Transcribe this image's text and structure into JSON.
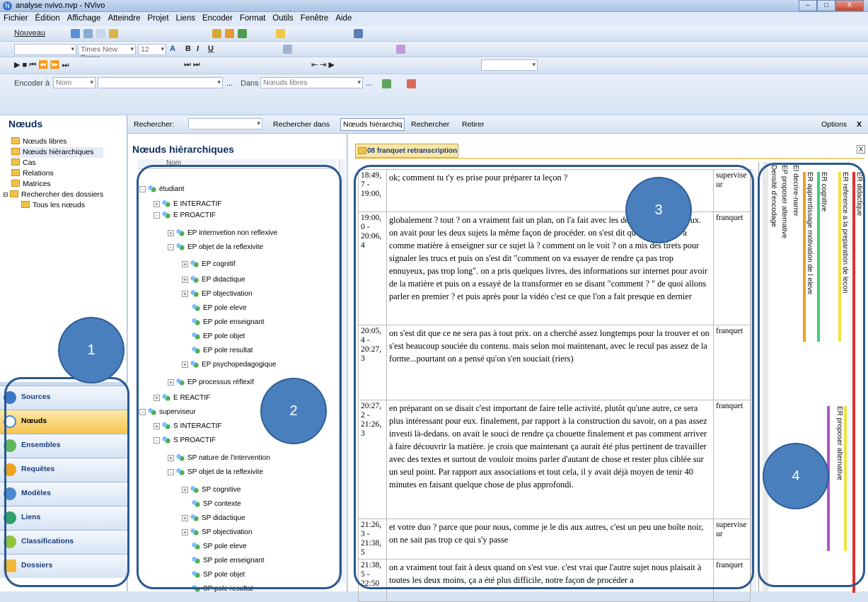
{
  "window": {
    "title": "analyse nvivo.nvp - NVivo",
    "min": "–",
    "max": "□",
    "close": "X"
  },
  "menu": [
    "Fichier",
    "Édition",
    "Affichage",
    "Atteindre",
    "Projet",
    "Liens",
    "Encoder",
    "Format",
    "Outils",
    "Fenêtre",
    "Aide"
  ],
  "toolbar": {
    "new_label": "Nouveau",
    "font_name": "Times New Roma",
    "font_size": "12",
    "encode_at": "Encoder à",
    "encode_field": "Nom",
    "in_label": "Dans",
    "in_value": "Nœuds libres"
  },
  "left": {
    "header": "Nœuds",
    "tree": [
      "Nœuds libres",
      "Nœuds hiérarchiques",
      "Cas",
      "Relations",
      "Matrices",
      "Rechercher des dossiers",
      "Tous les nœuds"
    ],
    "nav": [
      "Sources",
      "Nœuds",
      "Ensembles",
      "Requêtes",
      "Modèles",
      "Liens",
      "Classifications",
      "Dossiers"
    ]
  },
  "search": {
    "label": "Rechercher:",
    "search_in": "Rechercher dans",
    "scope": "Nœuds hiérarchiq",
    "find": "Rechercher",
    "clear": "Retirer",
    "options": "Options",
    "close": "X"
  },
  "middle": {
    "header": "Nœuds hiérarchiques",
    "col": "Nom",
    "nodes": [
      {
        "label": "étudiant",
        "lvl": 0,
        "exp": "-"
      },
      {
        "label": "E INTERACTIF",
        "lvl": 1,
        "exp": "+"
      },
      {
        "label": "E PROACTIF",
        "lvl": 1,
        "exp": "-"
      },
      {
        "label": "EP internvetion non reflexive",
        "lvl": 2,
        "exp": "+"
      },
      {
        "label": "EP objet de la reflexivite",
        "lvl": 2,
        "exp": "-"
      },
      {
        "label": "EP cognitif",
        "lvl": 3,
        "exp": "+"
      },
      {
        "label": "EP didactique",
        "lvl": 3,
        "exp": "+"
      },
      {
        "label": "EP objectivation",
        "lvl": 3,
        "exp": "+"
      },
      {
        "label": "EP pole eleve",
        "lvl": 3,
        "exp": ""
      },
      {
        "label": "EP pole enseignant",
        "lvl": 3,
        "exp": ""
      },
      {
        "label": "EP pole objet",
        "lvl": 3,
        "exp": ""
      },
      {
        "label": "EP pole resultat",
        "lvl": 3,
        "exp": ""
      },
      {
        "label": "EP psychopedagogique",
        "lvl": 3,
        "exp": "+"
      },
      {
        "label": "EP processus réflexif",
        "lvl": 2,
        "exp": "+"
      },
      {
        "label": "E REACTIF",
        "lvl": 1,
        "exp": "+"
      },
      {
        "label": "superviseur",
        "lvl": 0,
        "exp": "-"
      },
      {
        "label": "S INTERACTIF",
        "lvl": 1,
        "exp": "+"
      },
      {
        "label": "S PROACTIF",
        "lvl": 1,
        "exp": "-"
      },
      {
        "label": "SP nature de l'intervention",
        "lvl": 2,
        "exp": "+"
      },
      {
        "label": "SP objet de la reflexivite",
        "lvl": 2,
        "exp": "-"
      },
      {
        "label": "SP cognitive",
        "lvl": 3,
        "exp": "+"
      },
      {
        "label": "SP contexte",
        "lvl": 3,
        "exp": ""
      },
      {
        "label": "SP didactique",
        "lvl": 3,
        "exp": "+"
      },
      {
        "label": "SP objectivation",
        "lvl": 3,
        "exp": "+"
      },
      {
        "label": "SP pole eleve",
        "lvl": 3,
        "exp": ""
      },
      {
        "label": "SP pole enseignant",
        "lvl": 3,
        "exp": ""
      },
      {
        "label": "SP pole objet",
        "lvl": 3,
        "exp": ""
      },
      {
        "label": "SP pole resultat",
        "lvl": 3,
        "exp": ""
      }
    ]
  },
  "doc": {
    "tab": "08 franquet retranscription",
    "close": "X",
    "rows": [
      {
        "ts": "18:49, 7 - 19:00,",
        "sp": "supervise ur",
        "txt": "ok; comment tu t'y es prise pour préparer ta leçon ?"
      },
      {
        "ts": "19:00, 0 - 20:06, 4",
        "sp": "franquet",
        "txt": "globalement ? tout ? on a vraiment fait un plan, on l'a fait avec les deux sujets et les deux. on avait pour les deux sujets la même façon de procéder. on s'est dit qu'est ce qu'il y a comme matière à enseigner sur ce sujet là ? comment on le voit ? on a mis des tirets pour signaler les trucs et puis on s'est dit \"comment on va essayer de rendre ça pas trop ennuyeux, pas trop long\". on a pris quelques livres, des informations sur internet pour avoir de la matière et puis on a essayé de la transformer en se disant \"comment ? \" de quoi allons parler en premier ? et puis après pour la vidéo c'est ce que l'on a fait presque en dernier"
      },
      {
        "ts": "20:05, 4 - 20:27, 3",
        "sp": "franquet",
        "txt": "on s'est dit que ce ne sera pas à tout prix. on a cherché assez longtemps pour la trouver et on s'est beaucoup souciée du contenu. mais selon moi maintenant, avec le recul pas assez de la forme...pourtant on a pensé qu'on s'en souciait (riers)"
      },
      {
        "ts": "20:27, 2 - 21:26, 3",
        "sp": "franquet",
        "txt": "en préparant on se disait c'est important de faire telle activité, plutôt qu'une autre, ce sera plus intéressant pour eux. finalement, par rapport à la construction du savoir, on a pas assez investi là-dedans. on avait le souci de rendre ça chouette finalement et pas comment arriver à faire découvrir la matière. je crois que maintenant ça aurait été plus pertinent de travailler avec des textes et surtout de vouloir moins parler d'autant de chose et rester plus ciblée sur un seul point. Par rapport aux associations et tout cela, il y avait déjà moyen de tenir 40 minutes en faisant quelque chose de plus approfondi."
      },
      {
        "ts": "21:26, 3 - 21:38, 5",
        "sp": "supervise ur",
        "txt": "et votre duo ? parce que pour nous, comme je le dis aux autres, c'est un peu une boîte noir, on ne sait pas trop ce qui s'y passe"
      },
      {
        "ts": "21:38, 5 - 22:50",
        "sp": "franquet",
        "txt": "on a vraiment tout fait à deux quand on s'est vue. c'est vrai que l'autre sujet nous plaisait à toutes les deux moins, ça a été plus difficile, notre façon de procéder a"
      }
    ]
  },
  "coding": {
    "labels": [
      "Densité d'encodage",
      "EP proposer alternative",
      "EI decrire-narrer",
      "ER apprentissage motivation de l eleve",
      "ER cognitive",
      "ER reference a la preparation de lecon",
      "ER didactique",
      "ER proposer alternative"
    ],
    "colors": {
      "orange": "#f0a020",
      "green": "#3ed07a",
      "yellow": "#f2e040",
      "red": "#e23030",
      "purple": "#b054c8"
    }
  },
  "annotations": [
    "1",
    "2",
    "3",
    "4"
  ]
}
